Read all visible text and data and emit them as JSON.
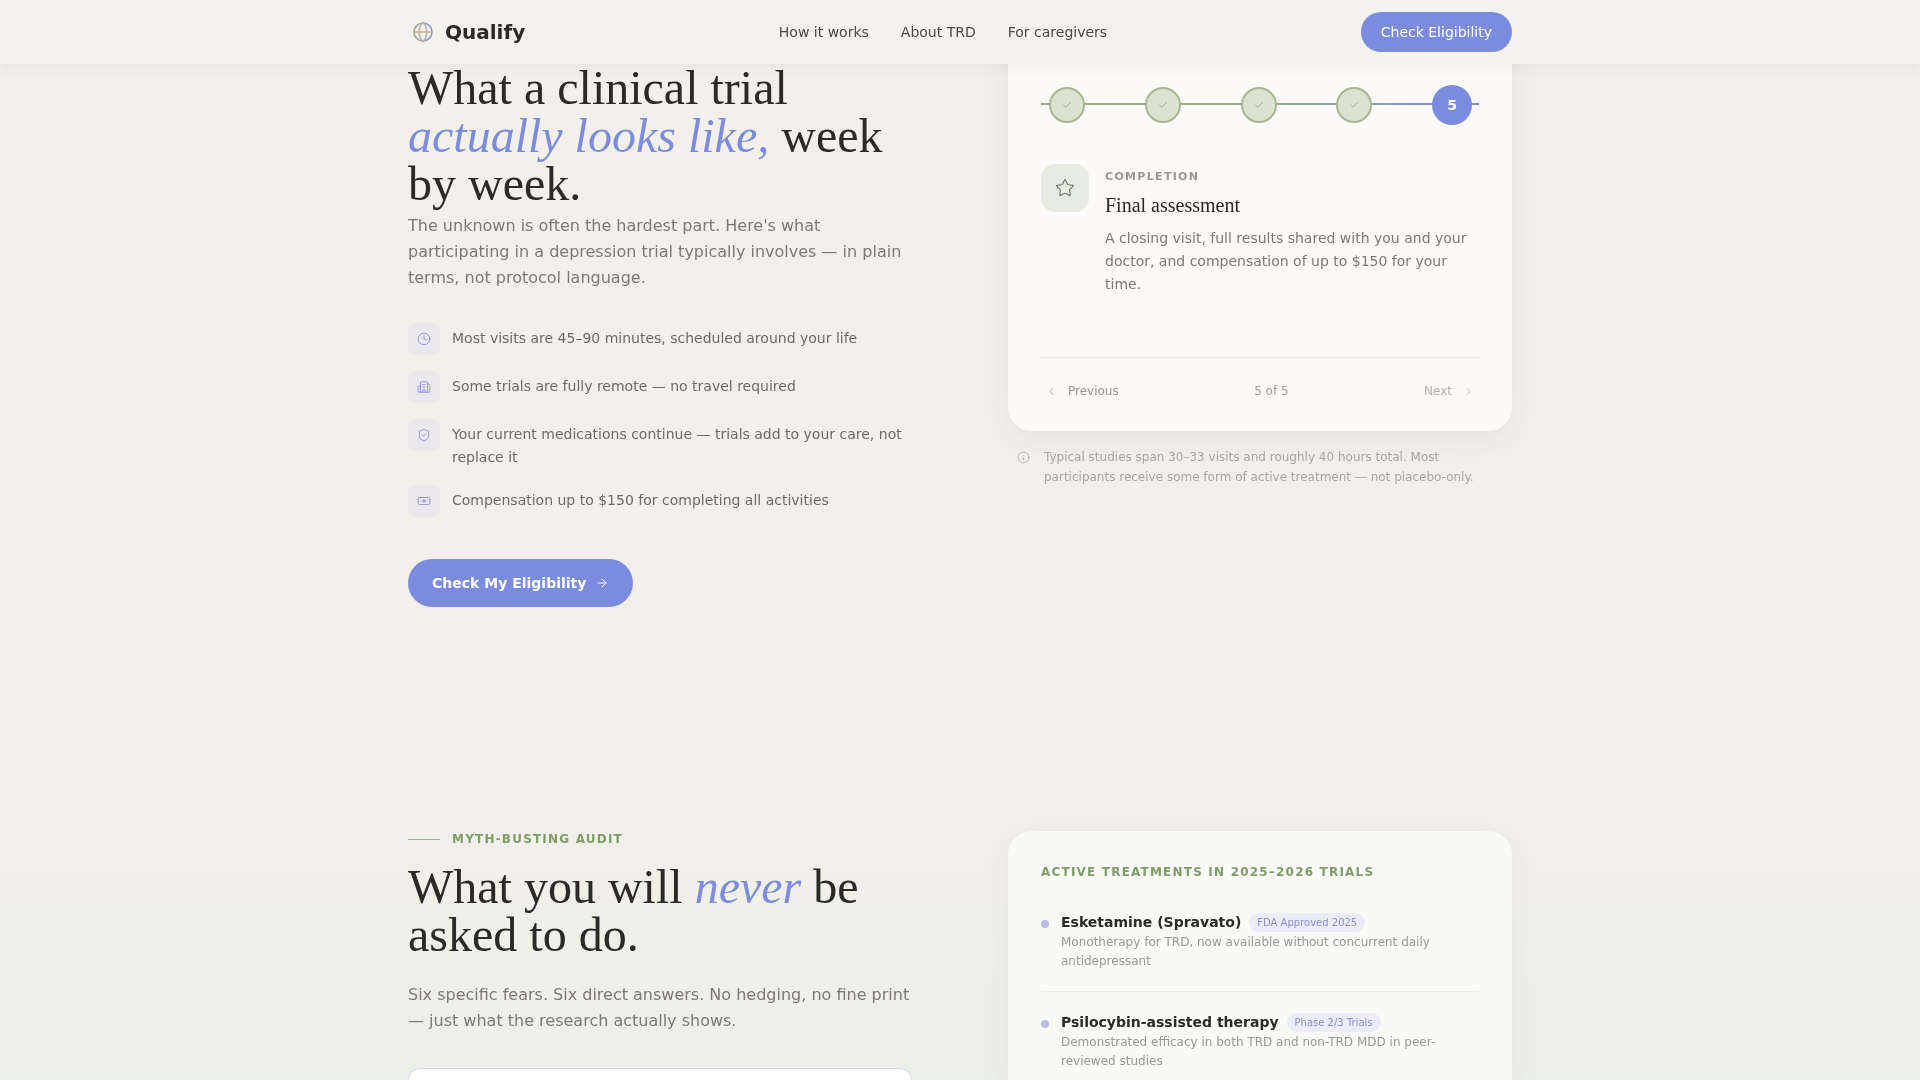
{
  "header": {
    "brand": "Qualify",
    "nav": [
      "How it works",
      "About TRD",
      "For caregivers"
    ],
    "cta": "Check Eligibility"
  },
  "hero": {
    "heading": "What a clinical trial *actually looks like,* week by week.",
    "intro": "The unknown is often the hardest part. Here's what participating in a depression trial typically involves — in plain terms, not protocol language.",
    "features": [
      "Most visits are 45–90 minutes, scheduled around your life",
      "Some trials are fully remote — no travel required",
      "Your current medications continue — trials add to your care, not replace it",
      "Compensation up to $150 for completing all activities"
    ],
    "cta": "Check My Eligibility"
  },
  "timeline": {
    "steps": [
      {
        "completed": true,
        "selected": false
      },
      {
        "completed": true,
        "selected": false
      },
      {
        "completed": true,
        "selected": false
      },
      {
        "completed": true,
        "selected": false
      },
      {
        "completed": false,
        "selected": true,
        "label": "5"
      }
    ],
    "detail": {
      "category": "COMPLETION",
      "title": "Final assessment",
      "description": "A closing visit, full results shared with you and your doctor, and compensation of up to $150 for your time."
    },
    "pager": {
      "previous": {
        "label": "Previous",
        "disabled": false
      },
      "position": "5 of 5",
      "next": {
        "label": "Next",
        "disabled": true
      }
    },
    "note": "Typical studies span 30–33 visits and roughly 40 hours total. Most participants receive some form of active treatment — not placebo-only."
  },
  "myths": {
    "eyebrow": "MYTH-BUSTING AUDIT",
    "heading": "What you will *never* be asked to do.",
    "intro": "Six specific fears. Six direct answers. No hedging, no fine print — just what the research actually shows."
  },
  "treatments": {
    "title": "ACTIVE TREATMENTS IN 2025–2026 TRIALS",
    "items": [
      {
        "name": "Esketamine (Spravato)",
        "badge": "FDA Approved 2025",
        "description": "Monotherapy for TRD, now available without concurrent daily antidepressant"
      },
      {
        "name": "Psilocybin-assisted therapy",
        "badge": "Phase 2/3 Trials",
        "description": "Demonstrated efficacy in both TRD and non-TRD MDD in peer-reviewed studies"
      }
    ]
  }
}
